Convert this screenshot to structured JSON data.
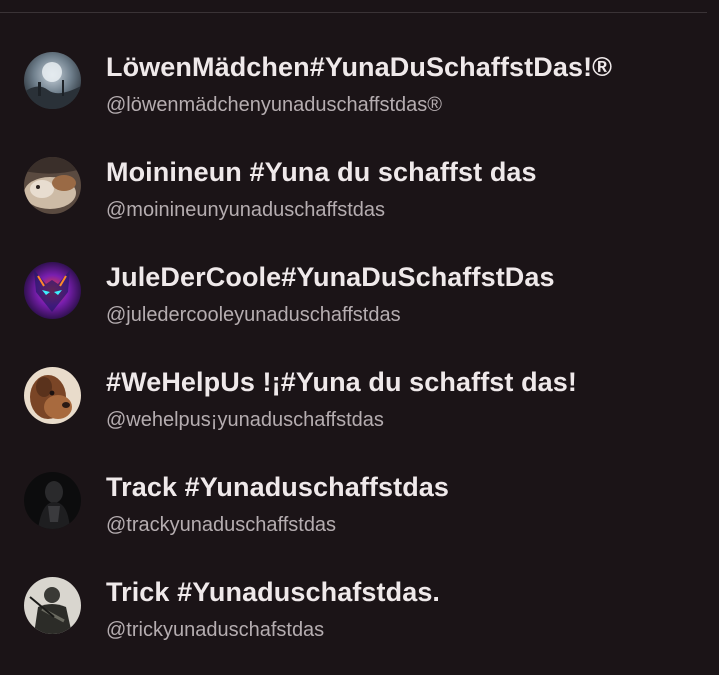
{
  "users": [
    {
      "display_name": "LöwenMädchen#YunaDuSchaffstDas!®",
      "handle": "@löwenmädchenyunaduschaffstdas®",
      "avatar_icon": "moon-landscape-avatar"
    },
    {
      "display_name": "Moinineun #Yuna du schaffst das",
      "handle": "@moinineunyunaduschaffstdas",
      "avatar_icon": "cat-avatar"
    },
    {
      "display_name": "JuleDerCoole#YunaDuSchaffstDas",
      "handle": "@juledercooleyunaduschaffstdas",
      "avatar_icon": "neon-wolf-avatar"
    },
    {
      "display_name": "#WeHelpUs !¡#Yuna du schaffst das!",
      "handle": "@wehelpus¡yunaduschaffstdas",
      "avatar_icon": "dog-avatar"
    },
    {
      "display_name": "Track #Yunaduschaffstdas",
      "handle": "@trackyunaduschaffstdas",
      "avatar_icon": "dark-figure-avatar"
    },
    {
      "display_name": "Trick #Yunaduschafstdas.",
      "handle": "@trickyunaduschafstdas",
      "avatar_icon": "armored-figure-avatar"
    }
  ]
}
